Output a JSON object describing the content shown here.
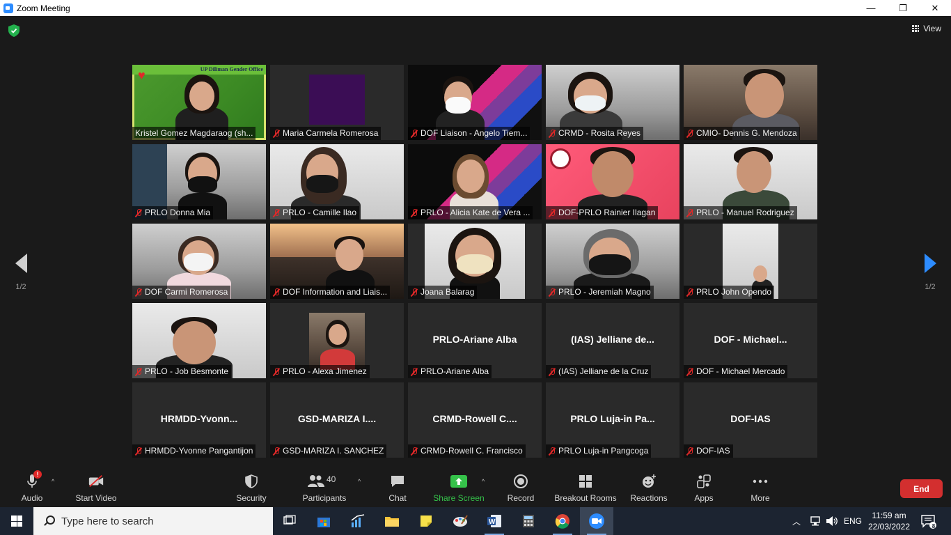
{
  "window": {
    "title": "Zoom Meeting",
    "minimize": "—",
    "restore": "❐",
    "close": "✕"
  },
  "top": {
    "view_label": "View"
  },
  "pagination": {
    "left": "1/2",
    "right": "1/2"
  },
  "tiles": [
    {
      "label": "Kristel Gomez Magdaraog (sh...",
      "muted": false,
      "kind": "video"
    },
    {
      "label": "Maria Carmela Romerosa",
      "muted": true,
      "kind": "video"
    },
    {
      "label": "DOF Liaison - Angelo Tiem...",
      "muted": true,
      "kind": "video"
    },
    {
      "label": "CRMD - Rosita Reyes",
      "muted": true,
      "kind": "video"
    },
    {
      "label": "CMIO- Dennis G. Mendoza",
      "muted": true,
      "kind": "video"
    },
    {
      "label": "PRLO Donna Mia",
      "muted": true,
      "kind": "video"
    },
    {
      "label": "PRLO - Camille Ilao",
      "muted": true,
      "kind": "video"
    },
    {
      "label": "PRLO - Alicia Kate de Vera ...",
      "muted": true,
      "kind": "video"
    },
    {
      "label": "DOF-PRLO Rainier Ilagan",
      "muted": true,
      "kind": "video"
    },
    {
      "label": "PRLO - Manuel Rodriguez",
      "muted": true,
      "kind": "video"
    },
    {
      "label": "DOF Carmi Romerosa",
      "muted": true,
      "kind": "video"
    },
    {
      "label": "DOF Information and Liais...",
      "muted": true,
      "kind": "video"
    },
    {
      "label": "Joana Balarag",
      "muted": true,
      "kind": "video"
    },
    {
      "label": "PRLO - Jeremiah Magno",
      "muted": true,
      "kind": "video"
    },
    {
      "label": "PRLO John Opendo",
      "muted": true,
      "kind": "video"
    },
    {
      "label": "PRLO - Job Besmonte",
      "muted": true,
      "kind": "video"
    },
    {
      "label": "PRLO - Alexa Jimenez",
      "muted": true,
      "kind": "video"
    },
    {
      "label": "PRLO-Ariane Alba",
      "center": "PRLO-Ariane Alba",
      "muted": true,
      "kind": "name"
    },
    {
      "label": "(IAS) Jelliane de la Cruz",
      "center": "(IAS) Jelliane de...",
      "muted": true,
      "kind": "name"
    },
    {
      "label": "DOF - Michael Mercado",
      "center": "DOF - Michael...",
      "muted": true,
      "kind": "name"
    },
    {
      "label": "HRMDD-Yvonne Pangantijon",
      "center": "HRMDD-Yvonn...",
      "muted": true,
      "kind": "name"
    },
    {
      "label": "GSD-MARIZA I. SANCHEZ",
      "center": "GSD-MARIZA I....",
      "muted": true,
      "kind": "name"
    },
    {
      "label": "CRMD-Rowell C. Francisco",
      "center": "CRMD-Rowell C....",
      "muted": true,
      "kind": "name"
    },
    {
      "label": "PRLO Luja-in Pangcoga",
      "center": "PRLO Luja-in Pa...",
      "muted": true,
      "kind": "name"
    },
    {
      "label": "DOF-IAS",
      "center": "DOF-IAS",
      "muted": true,
      "kind": "name"
    }
  ],
  "active_tile_banner": "UP Diliman Gender Office",
  "toolbar": {
    "audio": "Audio",
    "audio_badge": "!",
    "start_video": "Start Video",
    "security": "Security",
    "participants": "Participants",
    "participants_count": "40",
    "chat": "Chat",
    "share_screen": "Share Screen",
    "record": "Record",
    "breakout_rooms": "Breakout Rooms",
    "reactions": "Reactions",
    "apps": "Apps",
    "more": "More",
    "end": "End",
    "caret": "^"
  },
  "taskbar": {
    "search_placeholder": "Type here to search",
    "language": "ENG",
    "time": "11:59 am",
    "date": "22/03/2022",
    "notification_count": "8"
  },
  "colors": {
    "accent_blue": "#2d8cff",
    "share_green": "#35c24a",
    "end_red": "#d32f2f",
    "active_speaker": "#d7e36e"
  }
}
